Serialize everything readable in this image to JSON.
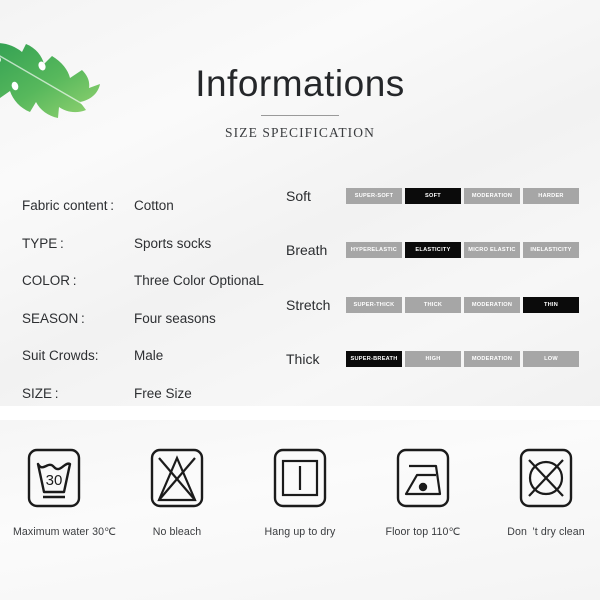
{
  "heading": {
    "title": "Informations",
    "subtitle": "SIZE SPECIFICATION"
  },
  "decoration": {
    "leaf_icon": "monstera-leaf-icon",
    "leaf_color_dark": "#2f9e52",
    "leaf_color_light": "#8ed16a"
  },
  "specs": [
    {
      "key": "Fabric content :",
      "value": "Cotton"
    },
    {
      "key": "TYPE :",
      "value": "Sports socks"
    },
    {
      "key": "COLOR :",
      "value": "Three Color OptionaL"
    },
    {
      "key": "SEASON :",
      "value": "Four seasons"
    },
    {
      "key": "Suit Crowds:",
      "value": "Male"
    },
    {
      "key": "SIZE :",
      "value": "Free Size"
    }
  ],
  "ratings": {
    "active_color": "#0b0b0b",
    "inactive_color": "#a6a6a6",
    "rows": [
      {
        "label": "Soft",
        "chips": [
          {
            "text": "SUPER-SOFT",
            "active": false
          },
          {
            "text": "SOFT",
            "active": true
          },
          {
            "text": "MODERATION",
            "active": false
          },
          {
            "text": "HARDER",
            "active": false
          }
        ]
      },
      {
        "label": "Breath",
        "chips": [
          {
            "text": "HYPERELASTIC",
            "active": false
          },
          {
            "text": "ELASTICITY",
            "active": true
          },
          {
            "text": "MICRO ELASTIC",
            "active": false
          },
          {
            "text": "INELASTICITY",
            "active": false
          }
        ]
      },
      {
        "label": "Stretch",
        "chips": [
          {
            "text": "SUPER-THICK",
            "active": false
          },
          {
            "text": "THICK",
            "active": false
          },
          {
            "text": "MODERATION",
            "active": false
          },
          {
            "text": "THIN",
            "active": true
          }
        ]
      },
      {
        "label": "Thick",
        "chips": [
          {
            "text": "SUPER-BREATH",
            "active": true
          },
          {
            "text": "HIGH",
            "active": false
          },
          {
            "text": "MODERATION",
            "active": false
          },
          {
            "text": "LOW",
            "active": false
          }
        ]
      }
    ]
  },
  "care": [
    {
      "icon": "wash-tub-30-icon",
      "temperature": "30",
      "caption": "Maximum water 30℃"
    },
    {
      "icon": "no-bleach-icon",
      "caption": "No bleach"
    },
    {
      "icon": "hang-up-to-dry-icon",
      "caption": "Hang up to dry"
    },
    {
      "icon": "iron-one-dot-icon",
      "caption": "Floor top 110℃"
    },
    {
      "icon": "do-not-dry-clean-icon",
      "caption": "Don ’t dry clean"
    }
  ]
}
